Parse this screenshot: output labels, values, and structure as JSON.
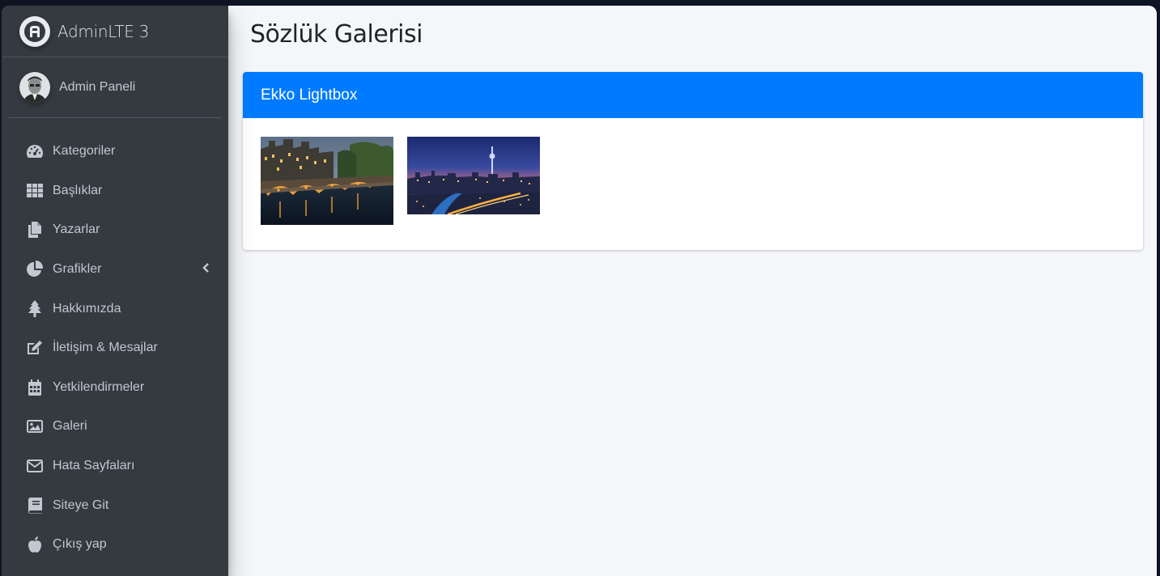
{
  "brand": {
    "name": "AdminLTE 3"
  },
  "user": {
    "name": "Admin Paneli"
  },
  "sidebar": {
    "items": [
      {
        "label": "Kategoriler",
        "icon": "tachometer-icon"
      },
      {
        "label": "Başlıklar",
        "icon": "grid-icon"
      },
      {
        "label": "Yazarlar",
        "icon": "copy-icon"
      },
      {
        "label": "Grafikler",
        "icon": "pie-chart-icon",
        "expandable": true
      },
      {
        "label": "Hakkımızda",
        "icon": "tree-icon"
      },
      {
        "label": "İletişim & Mesajlar",
        "icon": "edit-icon"
      },
      {
        "label": "Yetkilendirmeler",
        "icon": "calendar-icon"
      },
      {
        "label": "Galeri",
        "icon": "image-icon"
      },
      {
        "label": "Hata Sayfaları",
        "icon": "envelope-icon"
      },
      {
        "label": "Siteye Git",
        "icon": "book-icon"
      },
      {
        "label": "Çıkış yap",
        "icon": "apple-icon"
      }
    ]
  },
  "page": {
    "title": "Sözlük Galerisi"
  },
  "card": {
    "title": "Ekko Lightbox",
    "header_color": "#007bff",
    "images": [
      {
        "name": "gallery-thumbnail-canal-bridge"
      },
      {
        "name": "gallery-thumbnail-city-skyline"
      }
    ]
  },
  "colors": {
    "sidebar_bg": "#343a40",
    "sidebar_text": "#c2c7d0",
    "content_bg": "#f4f6f9",
    "accent": "#007bff"
  }
}
